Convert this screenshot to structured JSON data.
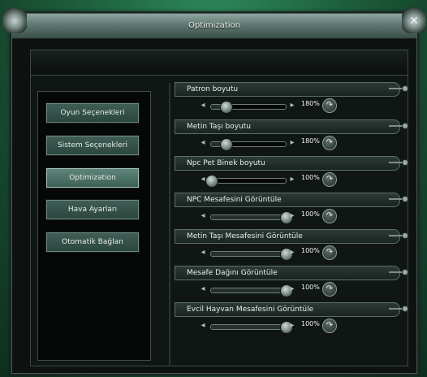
{
  "window": {
    "title": "Optimization"
  },
  "menu": [
    {
      "label": "Oyun Seçenekleri",
      "active": false
    },
    {
      "label": "Sistem Seçenekleri",
      "active": false
    },
    {
      "label": "Optimization",
      "active": true
    },
    {
      "label": "Hava Ayarları",
      "active": false
    },
    {
      "label": "Otomatik Bağlan",
      "active": false
    }
  ],
  "options": [
    {
      "label": "Patron boyutu",
      "value_text": "180%",
      "level": 0.2
    },
    {
      "label": "Metin Taşı boyutu",
      "value_text": "180%",
      "level": 0.2
    },
    {
      "label": "Npc Pet Binek boyutu",
      "value_text": "100%",
      "level": 0.0
    },
    {
      "label": "NPC Mesafesini Görüntüle",
      "value_text": "100%",
      "level": 1.0
    },
    {
      "label": "Metin Taşı Mesafesini Görüntüle",
      "value_text": "100%",
      "level": 1.0
    },
    {
      "label": "Mesafe Dağını Görüntüle",
      "value_text": "100%",
      "level": 1.0
    },
    {
      "label": "Evcil Hayvan Mesafesini Görüntüle",
      "value_text": "100%",
      "level": 1.0
    }
  ]
}
